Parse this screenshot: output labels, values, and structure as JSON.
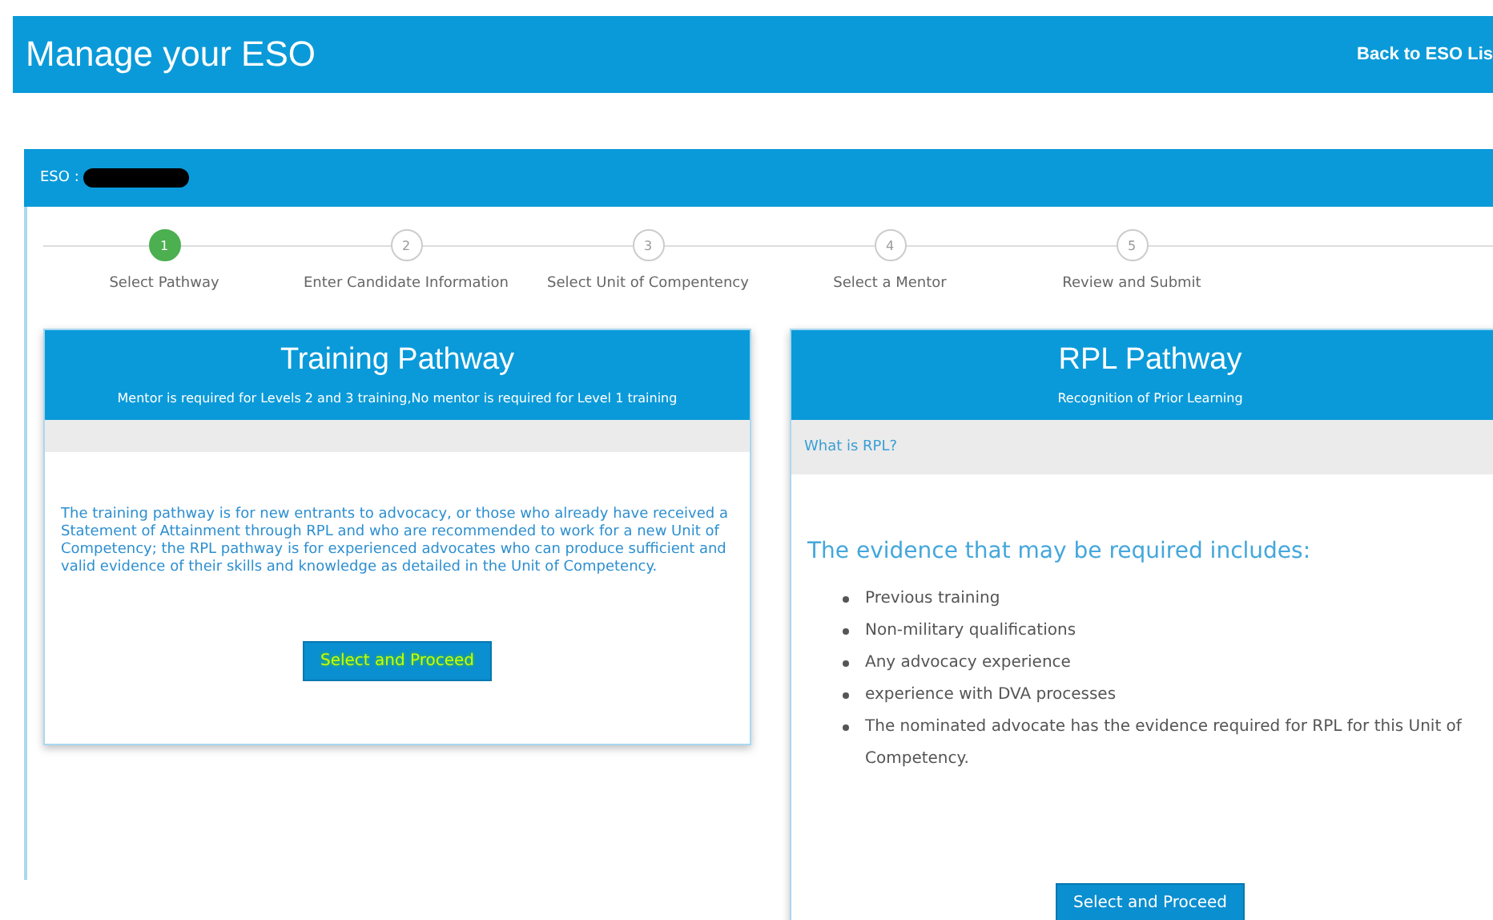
{
  "header": {
    "title": "Manage your ESO",
    "link": "Back to ESO Lis"
  },
  "panel": {
    "label": "ESO :",
    "redacted": true
  },
  "steps": [
    {
      "number": "1",
      "label": "Select Pathway",
      "selected": true
    },
    {
      "number": "2",
      "label": "Enter Candidate Information",
      "selected": false
    },
    {
      "number": "3",
      "label": "Select Unit of Compentency",
      "selected": false
    },
    {
      "number": "4",
      "label": "Select a Mentor",
      "selected": false
    },
    {
      "number": "5",
      "label": "Review and Submit",
      "selected": false
    }
  ],
  "cards": [
    {
      "title": "Training Pathway",
      "subtitle": "Mentor is required for Levels 2 and 3 training,No mentor is required for Level 1 training",
      "body": "The training pathway is for new entrants to advocacy, or those who already have received a Statement of Attainment through RPL and who are recommended to work for a new Unit of Competency; the RPL pathway is for experienced advocates who can produce sufficient and valid evidence of their skills and knowledge as detailed in the Unit of Competency.",
      "button": {
        "label": "Select and Proceed",
        "highlighted": true
      }
    },
    {
      "title": "RPL Pathway",
      "subtitle": "Recognition of Prior Learning",
      "bar_text": "What is RPL?",
      "heading": "The evidence that may be required includes:",
      "items": [
        "Previous training",
        "Non-military qualifications",
        "Any advocacy experience",
        "experience with DVA processes",
        "The nominated advocate has the evidence required for RPL for this Unit of Competency."
      ],
      "button": {
        "label": "Select and Proceed",
        "highlighted": false
      }
    }
  ]
}
